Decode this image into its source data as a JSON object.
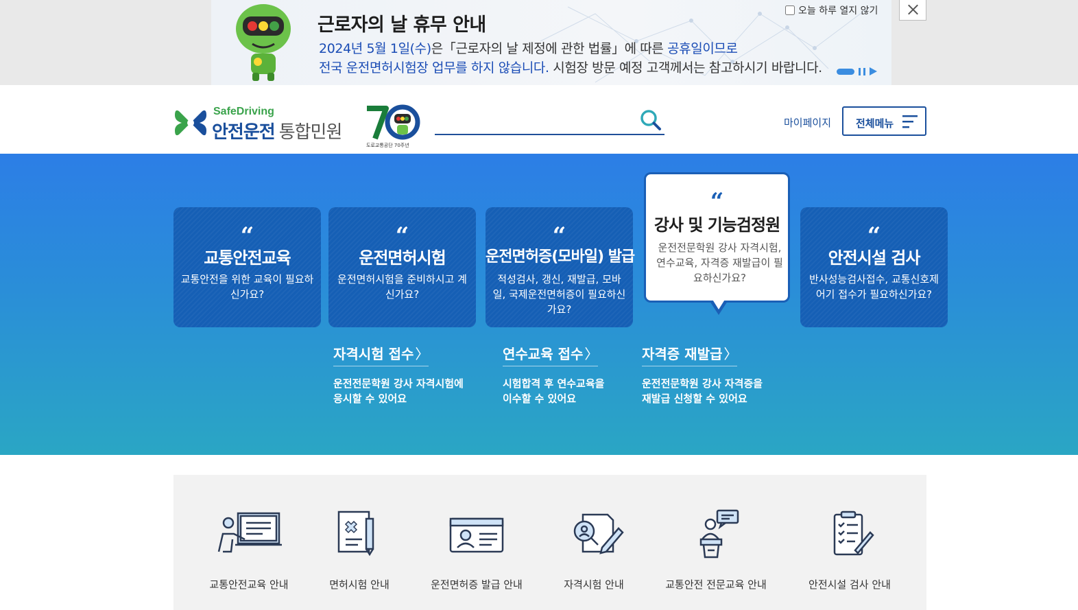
{
  "banner": {
    "title": "근로자의 날 휴무 안내",
    "line1_date": "2024년 5월 1일(수)",
    "line1_mid": "은「근로자의 날 제정에 관한 법률」에 따른 ",
    "line1_hl": "공휴일이므로",
    "line2_hl": "전국 운전면허시험장 업무를 하지 않습니다.",
    "line2_rest": " 시험장 방문 예정 고객께서는 참고하시기 바랍니다.",
    "today_close_label": "오늘 하루 열지 않기"
  },
  "header": {
    "logo_sub": "SafeDriving",
    "logo_main": "안전운전",
    "logo_gray": "통합민원",
    "logo_70_caption": "도로교통공단 70주년",
    "search_placeholder": "",
    "mypage": "마이페이지",
    "allmenu": "전체메뉴"
  },
  "cards": [
    {
      "title": "교통안전교육",
      "desc": "교통안전을 위한 교육이 필요하신가요?"
    },
    {
      "title": "운전면허시험",
      "desc": "운전면허시험을 준비하시고 계신가요?"
    },
    {
      "title": "운전면허증(모바일) 발급",
      "desc": "적성검사, 갱신, 재발급, 모바일, 국제운전면허증이 필요하신가요?"
    },
    {
      "title": "강사 및 기능검정원",
      "desc": "운전전문학원 강사 자격시험, 연수교육, 자격증 재발급이 필요하신가요?"
    },
    {
      "title": "안전시설 검사",
      "desc": "반사성능검사접수, 교통신호제어기 접수가 필요하신가요?"
    }
  ],
  "quote_mark": "“",
  "sub_links": [
    {
      "title": "자격시험 접수",
      "arrow": "〉",
      "desc1": "운전전문학원 강사 자격시험에",
      "desc2": "응시할 수 있어요"
    },
    {
      "title": "연수교육 접수",
      "arrow": "〉",
      "desc1": "시험합격 후 연수교육을",
      "desc2": "이수할 수 있어요"
    },
    {
      "title": "자격증 재발급",
      "arrow": "〉",
      "desc1": "운전전문학원 강사 자격증을",
      "desc2": "재발급 신청할 수 있어요"
    }
  ],
  "quick_services": [
    {
      "label": "교통안전교육 안내",
      "icon": "teacher-board-icon"
    },
    {
      "label": "면허시험 안내",
      "icon": "document-pen-icon"
    },
    {
      "label": "운전면허증 발급 안내",
      "icon": "id-card-icon"
    },
    {
      "label": "자격시험 안내",
      "icon": "exam-search-icon"
    },
    {
      "label": "교통안전 전문교육 안내",
      "icon": "lecture-podium-icon"
    },
    {
      "label": "안전시설 검사 안내",
      "icon": "checklist-icon"
    }
  ],
  "colors": {
    "brand_blue": "#1a4f9c",
    "card_blue": "#155fb5",
    "hero_top": "#2c7ee6",
    "hero_bottom": "#2aa6c4",
    "accent_green": "#3aa34b"
  }
}
